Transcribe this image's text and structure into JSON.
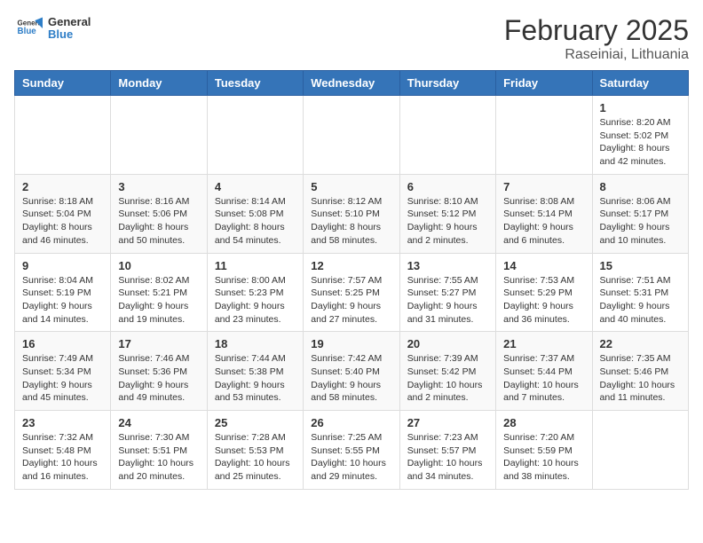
{
  "header": {
    "logo_general": "General",
    "logo_blue": "Blue",
    "month_title": "February 2025",
    "location": "Raseiniai, Lithuania"
  },
  "weekdays": [
    "Sunday",
    "Monday",
    "Tuesday",
    "Wednesday",
    "Thursday",
    "Friday",
    "Saturday"
  ],
  "weeks": [
    [
      {
        "day": "",
        "info": ""
      },
      {
        "day": "",
        "info": ""
      },
      {
        "day": "",
        "info": ""
      },
      {
        "day": "",
        "info": ""
      },
      {
        "day": "",
        "info": ""
      },
      {
        "day": "",
        "info": ""
      },
      {
        "day": "1",
        "info": "Sunrise: 8:20 AM\nSunset: 5:02 PM\nDaylight: 8 hours and 42 minutes."
      }
    ],
    [
      {
        "day": "2",
        "info": "Sunrise: 8:18 AM\nSunset: 5:04 PM\nDaylight: 8 hours and 46 minutes."
      },
      {
        "day": "3",
        "info": "Sunrise: 8:16 AM\nSunset: 5:06 PM\nDaylight: 8 hours and 50 minutes."
      },
      {
        "day": "4",
        "info": "Sunrise: 8:14 AM\nSunset: 5:08 PM\nDaylight: 8 hours and 54 minutes."
      },
      {
        "day": "5",
        "info": "Sunrise: 8:12 AM\nSunset: 5:10 PM\nDaylight: 8 hours and 58 minutes."
      },
      {
        "day": "6",
        "info": "Sunrise: 8:10 AM\nSunset: 5:12 PM\nDaylight: 9 hours and 2 minutes."
      },
      {
        "day": "7",
        "info": "Sunrise: 8:08 AM\nSunset: 5:14 PM\nDaylight: 9 hours and 6 minutes."
      },
      {
        "day": "8",
        "info": "Sunrise: 8:06 AM\nSunset: 5:17 PM\nDaylight: 9 hours and 10 minutes."
      }
    ],
    [
      {
        "day": "9",
        "info": "Sunrise: 8:04 AM\nSunset: 5:19 PM\nDaylight: 9 hours and 14 minutes."
      },
      {
        "day": "10",
        "info": "Sunrise: 8:02 AM\nSunset: 5:21 PM\nDaylight: 9 hours and 19 minutes."
      },
      {
        "day": "11",
        "info": "Sunrise: 8:00 AM\nSunset: 5:23 PM\nDaylight: 9 hours and 23 minutes."
      },
      {
        "day": "12",
        "info": "Sunrise: 7:57 AM\nSunset: 5:25 PM\nDaylight: 9 hours and 27 minutes."
      },
      {
        "day": "13",
        "info": "Sunrise: 7:55 AM\nSunset: 5:27 PM\nDaylight: 9 hours and 31 minutes."
      },
      {
        "day": "14",
        "info": "Sunrise: 7:53 AM\nSunset: 5:29 PM\nDaylight: 9 hours and 36 minutes."
      },
      {
        "day": "15",
        "info": "Sunrise: 7:51 AM\nSunset: 5:31 PM\nDaylight: 9 hours and 40 minutes."
      }
    ],
    [
      {
        "day": "16",
        "info": "Sunrise: 7:49 AM\nSunset: 5:34 PM\nDaylight: 9 hours and 45 minutes."
      },
      {
        "day": "17",
        "info": "Sunrise: 7:46 AM\nSunset: 5:36 PM\nDaylight: 9 hours and 49 minutes."
      },
      {
        "day": "18",
        "info": "Sunrise: 7:44 AM\nSunset: 5:38 PM\nDaylight: 9 hours and 53 minutes."
      },
      {
        "day": "19",
        "info": "Sunrise: 7:42 AM\nSunset: 5:40 PM\nDaylight: 9 hours and 58 minutes."
      },
      {
        "day": "20",
        "info": "Sunrise: 7:39 AM\nSunset: 5:42 PM\nDaylight: 10 hours and 2 minutes."
      },
      {
        "day": "21",
        "info": "Sunrise: 7:37 AM\nSunset: 5:44 PM\nDaylight: 10 hours and 7 minutes."
      },
      {
        "day": "22",
        "info": "Sunrise: 7:35 AM\nSunset: 5:46 PM\nDaylight: 10 hours and 11 minutes."
      }
    ],
    [
      {
        "day": "23",
        "info": "Sunrise: 7:32 AM\nSunset: 5:48 PM\nDaylight: 10 hours and 16 minutes."
      },
      {
        "day": "24",
        "info": "Sunrise: 7:30 AM\nSunset: 5:51 PM\nDaylight: 10 hours and 20 minutes."
      },
      {
        "day": "25",
        "info": "Sunrise: 7:28 AM\nSunset: 5:53 PM\nDaylight: 10 hours and 25 minutes."
      },
      {
        "day": "26",
        "info": "Sunrise: 7:25 AM\nSunset: 5:55 PM\nDaylight: 10 hours and 29 minutes."
      },
      {
        "day": "27",
        "info": "Sunrise: 7:23 AM\nSunset: 5:57 PM\nDaylight: 10 hours and 34 minutes."
      },
      {
        "day": "28",
        "info": "Sunrise: 7:20 AM\nSunset: 5:59 PM\nDaylight: 10 hours and 38 minutes."
      },
      {
        "day": "",
        "info": ""
      }
    ]
  ]
}
